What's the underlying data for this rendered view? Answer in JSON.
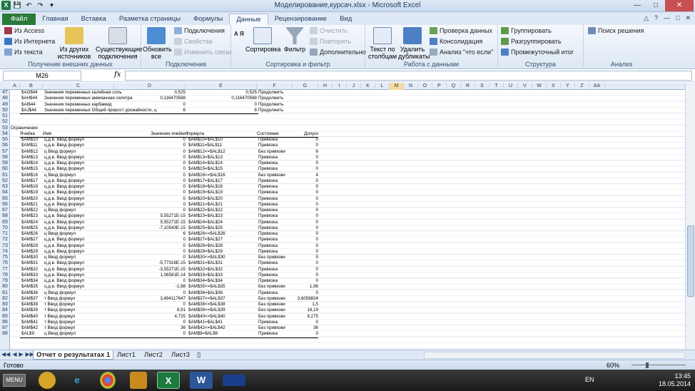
{
  "window": {
    "title": "Моделирование,курсач.xlsx - Microsoft Excel"
  },
  "tabs": [
    "Файл",
    "Главная",
    "Вставка",
    "Разметка страницы",
    "Формулы",
    "Данные",
    "Рецензирование",
    "Вид"
  ],
  "ribbon": {
    "ext": {
      "access": "Из Access",
      "web": "Из Интернета",
      "text": "Из текста",
      "other": "Из других источников",
      "existing": "Существующие подключения",
      "label": "Получение внешних данных"
    },
    "conn": {
      "refresh": "Обновить все",
      "connections": "Подключения",
      "properties": "Свойства",
      "editlinks": "Изменить связи",
      "label": "Подключения"
    },
    "sort": {
      "az": "А Я",
      "sort": "Сортировка",
      "filter": "Фильтр",
      "clear": "Очистить",
      "reapply": "Повторить",
      "advanced": "Дополнительно",
      "label": "Сортировка и фильтр"
    },
    "tools": {
      "t2c": "Текст по столбцам",
      "dup": "Удалить дубликаты",
      "validate": "Проверка данных",
      "consolidate": "Консолидация",
      "whatif": "Анализ \"что если\"",
      "label": "Работа с данными"
    },
    "outline": {
      "group": "Группировать",
      "ungroup": "Разгруппировать",
      "subtotal": "Промежуточный итог",
      "label": "Структура"
    },
    "analysis": {
      "solver": "Поиск решения",
      "label": "Анализ"
    }
  },
  "namebox": "M26",
  "columns": [
    "A",
    "B",
    "C",
    "D",
    "E",
    "F",
    "G",
    "H",
    "I",
    "J",
    "K",
    "L",
    "M",
    "N",
    "O",
    "P",
    "Q",
    "R",
    "S",
    "T",
    "U",
    "V",
    "W",
    "X",
    "Y",
    "Z",
    "AA"
  ],
  "rows": [
    "47",
    "48",
    "49",
    "50",
    "51",
    "52",
    "53",
    "54",
    "55",
    "56",
    "57",
    "58",
    "59",
    "60",
    "61",
    "62",
    "63",
    "64",
    "65",
    "66",
    "67",
    "68",
    "69",
    "70",
    "71",
    "72",
    "73",
    "74",
    "75",
    "76",
    "77",
    "78",
    "79",
    "80",
    "81",
    "82",
    "83",
    "84",
    "85",
    "86",
    "87",
    "88"
  ],
  "top_rows": [
    [
      "$AG$44",
      "Значения переменных калийная соль",
      "0,525",
      "0,525",
      "Продолжить"
    ],
    [
      "$AH$44",
      "Значения переменных аммиачная селитра",
      "0,116470588",
      "0,116470588",
      "Продолжить"
    ],
    [
      "$AI$44",
      "Значения переменных карбамид",
      "0",
      "0",
      "Продолжить"
    ],
    [
      "$AJ$44",
      "Значения переменных Общий прирост урожайности, ц",
      "6",
      "6",
      "Продолжить"
    ]
  ],
  "constraints_title": "Ограничения",
  "headers": [
    "Ячейка",
    "Имя",
    "Значение ячейки",
    "Формула",
    "Состояние",
    "Допуск"
  ],
  "constraints": [
    [
      "$AM$10",
      "ц.д.в. Ввод формул",
      "0",
      "$AM$10=$AL$10",
      "Привязка",
      "0"
    ],
    [
      "$AM$11",
      "ц.д.в. Ввод формул",
      "0",
      "$AM$11=$AL$11",
      "Привязка",
      "0"
    ],
    [
      "$AM$12",
      "ц Ввод формул",
      "0",
      "$AM$12<=$AL$12",
      "Без привязки",
      "6"
    ],
    [
      "$AM$13",
      "ц.д.в. Ввод формул",
      "0",
      "$AM$13=$AL$13",
      "Привязка",
      "0"
    ],
    [
      "$AM$14",
      "ц.д.в. Ввод формул",
      "0",
      "$AM$14=$AL$14",
      "Привязка",
      "0"
    ],
    [
      "$AM$15",
      "ц.д.в. Ввод формул",
      "0",
      "$AM$15=$AL$15",
      "Привязка",
      "0"
    ],
    [
      "$AM$16",
      "ц Ввод формул",
      "0",
      "$AM$16<=$AL$16",
      "Без привязки",
      "4"
    ],
    [
      "$AM$17",
      "ц.д.в. Ввод формул",
      "0",
      "$AM$17=$AL$17",
      "Привязка",
      "0"
    ],
    [
      "$AM$18",
      "ц.д.в. Ввод формул",
      "0",
      "$AM$18=$AL$18",
      "Привязка",
      "0"
    ],
    [
      "$AM$19",
      "ц.д.в. Ввод формул",
      "0",
      "$AM$19=$AL$19",
      "Привязка",
      "0"
    ],
    [
      "$AM$20",
      "ц.д.в. Ввод формул",
      "0",
      "$AM$20=$AL$20",
      "Привязка",
      "0"
    ],
    [
      "$AM$21",
      "ц.д.в. Ввод формул",
      "0",
      "$AM$21=$AL$21",
      "Привязка",
      "0"
    ],
    [
      "$AM$22",
      "ц Ввод формул",
      "0",
      "$AM$22=$AL$22",
      "Привязка",
      "0"
    ],
    [
      "$AM$23",
      "ц.д.в. Ввод формул",
      "5,55271E-15",
      "$AM$23=$AL$23",
      "Привязка",
      "0"
    ],
    [
      "$AM$24",
      "ц.д.в. Ввод формул",
      "5,55271E-15",
      "$AM$24=$AL$24",
      "Привязка",
      "0"
    ],
    [
      "$AM$25",
      "ц.д.в. Ввод формул",
      "-7,10543E-15",
      "$AM$25=$AL$25",
      "Привязка",
      "0"
    ],
    [
      "$AM$26",
      "ц Ввод формул",
      "6",
      "$AM$26<=$AL$26",
      "Привязка",
      "0"
    ],
    [
      "$AM$27",
      "ц.д.в. Ввод формул",
      "0",
      "$AM$27=$AL$27",
      "Привязка",
      "0"
    ],
    [
      "$AM$28",
      "ц.д.в. Ввод формул",
      "0",
      "$AM$28=$AL$28",
      "Привязка",
      "0"
    ],
    [
      "$AM$29",
      "ц.д.в. Ввод формул",
      "0",
      "$AM$29=$AL$29",
      "Привязка",
      "0"
    ],
    [
      "$AM$30",
      "ц Ввод формул",
      "0",
      "$AM$30<=$AL$30",
      "Без привязки",
      "5"
    ],
    [
      "$AM$31",
      "ц.д.в. Ввод формул",
      "-5,77316E-15",
      "$AM$31=$AL$31",
      "Привязка",
      "0"
    ],
    [
      "$AM$32",
      "ц.д.в. Ввод формул",
      "-3,55271E-15",
      "$AM$32=$AL$32",
      "Привязка",
      "0"
    ],
    [
      "$AM$33",
      "ц.д.в. Ввод формул",
      "1,06581E-14",
      "$AM$33=$AL$33",
      "Привязка",
      "0"
    ],
    [
      "$AM$34",
      "ц.д.в. Ввод формул",
      "0",
      "$AM$34=$AL$34",
      "Привязка",
      "0"
    ],
    [
      "$AM$35",
      "ц.д.в. Ввод формул",
      "-1,98",
      "$AM$35<=$AL$35",
      "Без привязки",
      "1,98"
    ],
    [
      "$AM$36",
      "ц Ввод формул",
      "0",
      "$AM$36=$AL$36",
      "Привязка",
      "0"
    ],
    [
      "$AM$37",
      "т Ввод формул",
      "3,494117647",
      "$AM$37<=$AL$37",
      "Без привязки",
      "3,6058824"
    ],
    [
      "$AM$38",
      "т Ввод формул",
      "0",
      "$AM$38<=$AL$38",
      "Без привязки",
      "1,5"
    ],
    [
      "$AM$39",
      "т Ввод формул",
      "8,91",
      "$AM$39<=$AL$39",
      "Без привязки",
      "18,19"
    ],
    [
      "$AM$40",
      "т Ввод формул",
      "4,725",
      "$AM$40<=$AL$40",
      "Без привязки",
      "8,275"
    ],
    [
      "$AM$41",
      "т Ввод формул",
      "0",
      "$AM$41=$AL$41",
      "Привязка",
      "0"
    ],
    [
      "$AM$42",
      "т Ввод формул",
      "36",
      "$AM$42<=$AL$42",
      "Без привязки",
      "36"
    ],
    [
      "$AL$9",
      "ц Ввод формул",
      "0",
      "$AM$9=$AL$9",
      "Привязка",
      "0"
    ]
  ],
  "sheets": [
    "Отчет о результатах 1",
    "Лист1",
    "Лист2",
    "Лист3"
  ],
  "status": {
    "ready": "Готово",
    "zoom": "60%"
  },
  "taskbar": {
    "menu": "MENU",
    "lang": "EN",
    "time": "13:45",
    "date": "18.05.2014"
  },
  "colors": {
    "accent": "#2a7a3a",
    "selected_header": "#f9d99f",
    "ribbon": "#dde8f4"
  }
}
